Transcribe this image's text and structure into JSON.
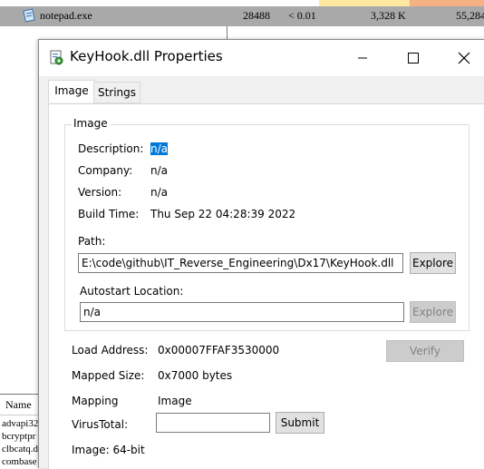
{
  "background": {
    "process_row": {
      "name": "notepad.exe",
      "pid": "28488",
      "cpu": "< 0.01",
      "private_bytes": "3,328 K",
      "working_set": "55,284"
    },
    "lower_pane": {
      "column_header": "Name",
      "items": [
        "advapi32",
        "bcryptpr",
        "clbcatq.d",
        "combase"
      ]
    },
    "colors": {
      "row_bg": "#a9a9a9",
      "strip_yellow": "#ffe8a0",
      "strip_salmon": "#f4b183"
    }
  },
  "dialog": {
    "title": "KeyHook.dll Properties",
    "app_icon": "dll-gear-icon",
    "controls": {
      "minimize": "minimize-icon",
      "maximize": "maximize-icon",
      "close": "close-icon"
    },
    "tabs": [
      {
        "label": "Image",
        "active": true
      },
      {
        "label": "Strings",
        "active": false
      }
    ],
    "image_group": {
      "legend": "Image",
      "description_label": "Description:",
      "description_value": "n/a",
      "company_label": "Company:",
      "company_value": "n/a",
      "version_label": "Version:",
      "version_value": "n/a",
      "build_time_label": "Build Time:",
      "build_time_value": "Thu Sep 22 04:28:39 2022",
      "path_label": "Path:",
      "path_value": "E:\\code\\github\\IT_Reverse_Engineering\\Dx17\\KeyHook.dll",
      "path_explore_button": "Explore",
      "autostart_label": "Autostart Location:",
      "autostart_value": "n/a",
      "autostart_explore_button": "Explore"
    },
    "load_address_label": "Load Address:",
    "load_address_value": "0x00007FFAF3530000",
    "verify_button": "Verify",
    "mapped_size_label": "Mapped Size:",
    "mapped_size_value": "0x7000 bytes",
    "mapping_label": "Mapping",
    "mapping_value": "Image",
    "virustotal_label": "VirusTotal:",
    "virustotal_value": "",
    "submit_button": "Submit",
    "image_bits": "Image: 64-bit",
    "colors": {
      "selection": "#0078d7",
      "dialog_bg": "#f0f0f0"
    }
  }
}
